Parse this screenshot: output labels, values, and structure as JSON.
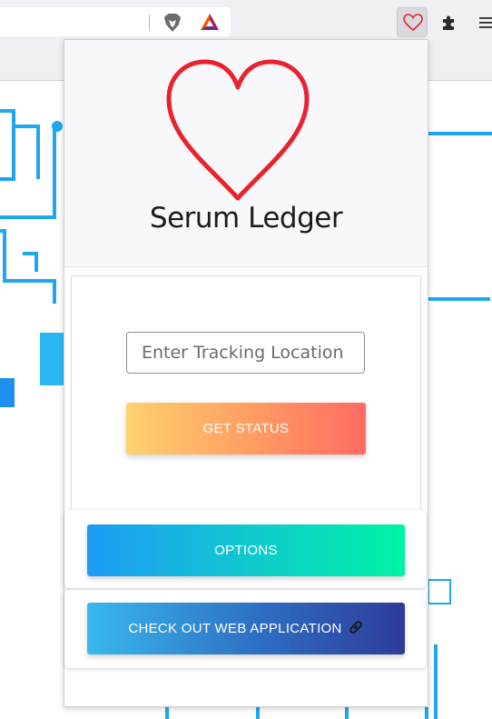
{
  "extension": {
    "brand_name": "Serum Ledger",
    "tracking_input_placeholder": "Enter Tracking Location",
    "tracking_input_value": "",
    "get_status_label": "GET STATUS",
    "options_label": "OPTIONS",
    "web_app_label": "CHECK OUT WEB APPLICATION"
  },
  "icons": {
    "toolbar": [
      "brave-lion-icon",
      "bat-rewards-icon",
      "serum-ledger-heart-icon",
      "extensions-puzzle-icon",
      "menu-icon"
    ],
    "logo": "heart-outline-icon",
    "web_app_button": "link-icon"
  },
  "colors": {
    "heart_red": "#e8232e",
    "get_status_gradient": [
      "#ffd16e",
      "#ff6b62"
    ],
    "options_gradient": [
      "#1e9bf5",
      "#00f3a5"
    ],
    "web_app_gradient": [
      "#39b8ee",
      "#2e3b9a"
    ],
    "background_lines": "#1ea7ef"
  }
}
